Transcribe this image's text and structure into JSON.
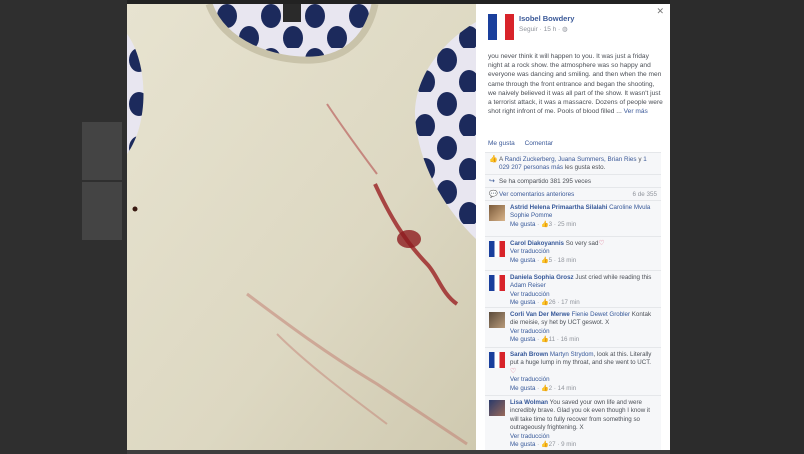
{
  "author": {
    "name": "Isobel Bowdery",
    "follow": "Seguir",
    "time": "15 h",
    "globe": "◍"
  },
  "close": "✕",
  "post": {
    "text": "you never think it will happen to you. It was just a friday night at a rock show. the atmosphere was so happy and everyone was dancing and smiling. and then when the men came through the front entrance and began the shooting, we naively believed it was all part of the show. It wasn't just a terrorist attack, it was a massacre. Dozens of people were shot right infront of me. Pools of blood filled ...",
    "more": "Ver más"
  },
  "actions": {
    "like": "Me gusta",
    "comment": "Comentar"
  },
  "likes": {
    "prefix": "A",
    "names": "Randi Zuckerberg, Juana Summers, Brian Ries",
    "mid": "y",
    "others": "1 029 207 personas más",
    "suffix": "les gusta esto."
  },
  "shares": "Se ha compartido 381 295 veces",
  "previous": {
    "label": "Ver comentarios anteriores",
    "count": "6 de 355"
  },
  "comments": [
    {
      "name": "Astrid Helena Primaartha Silalahi",
      "tag": "Caroline Mvula Sophie Pomme",
      "text": "",
      "translate": "",
      "like": "Me gusta",
      "likes": "3",
      "time": "25 min",
      "heart": ""
    },
    {
      "name": "Carol Diakoyannis",
      "tag": "",
      "text": "So very sad",
      "translate": "Ver traducción",
      "like": "Me gusta",
      "likes": "5",
      "time": "18 min",
      "heart": "♡"
    },
    {
      "name": "Daniela Sophia Grosz",
      "tag": "",
      "text": "Just cried while reading this",
      "tag2": "Adam Reiser",
      "translate": "Ver traducción",
      "like": "Me gusta",
      "likes": "26",
      "time": "17 min",
      "heart": ""
    },
    {
      "name": "Corli Van Der Merwe",
      "tag": "Fienie Dewet Grobler",
      "text": "Kontak die meisie, sy het by UCT geswot. X",
      "translate": "Ver traducción",
      "like": "Me gusta",
      "likes": "11",
      "time": "16 min",
      "heart": ""
    },
    {
      "name": "Sarah Brown",
      "tag": "Martyn Strydom",
      "text": ", look at this. Literally put a huge lump in my throat, and she went to UCT.",
      "translate": "Ver traducción",
      "like": "Me gusta",
      "likes": "2",
      "time": "14 min",
      "heart": "♡"
    },
    {
      "name": "Lisa Wolman",
      "tag": "",
      "text": "You saved your own life and were incredibly brave. Glad you ok even though I know it will take time to fully recover from something so outrageously frightening. X",
      "translate": "Ver traducción",
      "like": "Me gusta",
      "likes": "27",
      "time": "9 min",
      "heart": ""
    }
  ],
  "colors": {
    "link": "#365899",
    "flag_blue": "#1a3f9c",
    "flag_white": "#ffffff",
    "flag_red": "#d8232a"
  }
}
